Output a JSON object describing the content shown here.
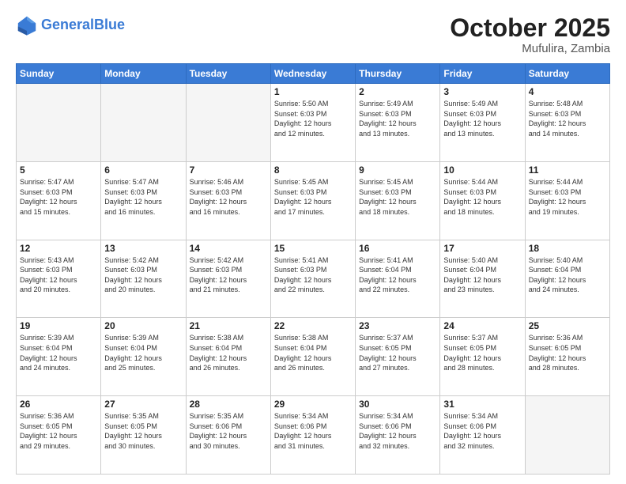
{
  "header": {
    "logo_general": "General",
    "logo_blue": "Blue",
    "month": "October 2025",
    "location": "Mufulira, Zambia"
  },
  "days_of_week": [
    "Sunday",
    "Monday",
    "Tuesday",
    "Wednesday",
    "Thursday",
    "Friday",
    "Saturday"
  ],
  "weeks": [
    [
      {
        "day": "",
        "text": ""
      },
      {
        "day": "",
        "text": ""
      },
      {
        "day": "",
        "text": ""
      },
      {
        "day": "1",
        "text": "Sunrise: 5:50 AM\nSunset: 6:03 PM\nDaylight: 12 hours\nand 12 minutes."
      },
      {
        "day": "2",
        "text": "Sunrise: 5:49 AM\nSunset: 6:03 PM\nDaylight: 12 hours\nand 13 minutes."
      },
      {
        "day": "3",
        "text": "Sunrise: 5:49 AM\nSunset: 6:03 PM\nDaylight: 12 hours\nand 13 minutes."
      },
      {
        "day": "4",
        "text": "Sunrise: 5:48 AM\nSunset: 6:03 PM\nDaylight: 12 hours\nand 14 minutes."
      }
    ],
    [
      {
        "day": "5",
        "text": "Sunrise: 5:47 AM\nSunset: 6:03 PM\nDaylight: 12 hours\nand 15 minutes."
      },
      {
        "day": "6",
        "text": "Sunrise: 5:47 AM\nSunset: 6:03 PM\nDaylight: 12 hours\nand 16 minutes."
      },
      {
        "day": "7",
        "text": "Sunrise: 5:46 AM\nSunset: 6:03 PM\nDaylight: 12 hours\nand 16 minutes."
      },
      {
        "day": "8",
        "text": "Sunrise: 5:45 AM\nSunset: 6:03 PM\nDaylight: 12 hours\nand 17 minutes."
      },
      {
        "day": "9",
        "text": "Sunrise: 5:45 AM\nSunset: 6:03 PM\nDaylight: 12 hours\nand 18 minutes."
      },
      {
        "day": "10",
        "text": "Sunrise: 5:44 AM\nSunset: 6:03 PM\nDaylight: 12 hours\nand 18 minutes."
      },
      {
        "day": "11",
        "text": "Sunrise: 5:44 AM\nSunset: 6:03 PM\nDaylight: 12 hours\nand 19 minutes."
      }
    ],
    [
      {
        "day": "12",
        "text": "Sunrise: 5:43 AM\nSunset: 6:03 PM\nDaylight: 12 hours\nand 20 minutes."
      },
      {
        "day": "13",
        "text": "Sunrise: 5:42 AM\nSunset: 6:03 PM\nDaylight: 12 hours\nand 20 minutes."
      },
      {
        "day": "14",
        "text": "Sunrise: 5:42 AM\nSunset: 6:03 PM\nDaylight: 12 hours\nand 21 minutes."
      },
      {
        "day": "15",
        "text": "Sunrise: 5:41 AM\nSunset: 6:03 PM\nDaylight: 12 hours\nand 22 minutes."
      },
      {
        "day": "16",
        "text": "Sunrise: 5:41 AM\nSunset: 6:04 PM\nDaylight: 12 hours\nand 22 minutes."
      },
      {
        "day": "17",
        "text": "Sunrise: 5:40 AM\nSunset: 6:04 PM\nDaylight: 12 hours\nand 23 minutes."
      },
      {
        "day": "18",
        "text": "Sunrise: 5:40 AM\nSunset: 6:04 PM\nDaylight: 12 hours\nand 24 minutes."
      }
    ],
    [
      {
        "day": "19",
        "text": "Sunrise: 5:39 AM\nSunset: 6:04 PM\nDaylight: 12 hours\nand 24 minutes."
      },
      {
        "day": "20",
        "text": "Sunrise: 5:39 AM\nSunset: 6:04 PM\nDaylight: 12 hours\nand 25 minutes."
      },
      {
        "day": "21",
        "text": "Sunrise: 5:38 AM\nSunset: 6:04 PM\nDaylight: 12 hours\nand 26 minutes."
      },
      {
        "day": "22",
        "text": "Sunrise: 5:38 AM\nSunset: 6:04 PM\nDaylight: 12 hours\nand 26 minutes."
      },
      {
        "day": "23",
        "text": "Sunrise: 5:37 AM\nSunset: 6:05 PM\nDaylight: 12 hours\nand 27 minutes."
      },
      {
        "day": "24",
        "text": "Sunrise: 5:37 AM\nSunset: 6:05 PM\nDaylight: 12 hours\nand 28 minutes."
      },
      {
        "day": "25",
        "text": "Sunrise: 5:36 AM\nSunset: 6:05 PM\nDaylight: 12 hours\nand 28 minutes."
      }
    ],
    [
      {
        "day": "26",
        "text": "Sunrise: 5:36 AM\nSunset: 6:05 PM\nDaylight: 12 hours\nand 29 minutes."
      },
      {
        "day": "27",
        "text": "Sunrise: 5:35 AM\nSunset: 6:05 PM\nDaylight: 12 hours\nand 30 minutes."
      },
      {
        "day": "28",
        "text": "Sunrise: 5:35 AM\nSunset: 6:06 PM\nDaylight: 12 hours\nand 30 minutes."
      },
      {
        "day": "29",
        "text": "Sunrise: 5:34 AM\nSunset: 6:06 PM\nDaylight: 12 hours\nand 31 minutes."
      },
      {
        "day": "30",
        "text": "Sunrise: 5:34 AM\nSunset: 6:06 PM\nDaylight: 12 hours\nand 32 minutes."
      },
      {
        "day": "31",
        "text": "Sunrise: 5:34 AM\nSunset: 6:06 PM\nDaylight: 12 hours\nand 32 minutes."
      },
      {
        "day": "",
        "text": ""
      }
    ]
  ]
}
